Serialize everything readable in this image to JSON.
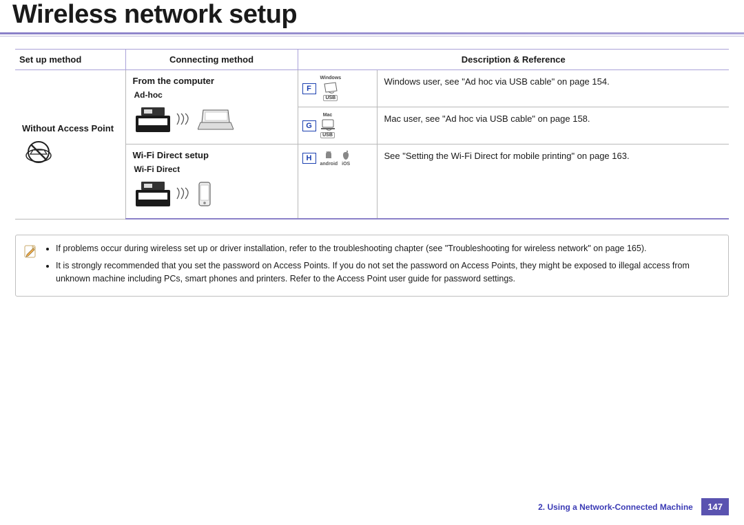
{
  "header": {
    "title": "Wireless network setup"
  },
  "table": {
    "headers": {
      "setup": "Set up method",
      "connecting": "Connecting method",
      "description": "Description & Reference"
    },
    "setup_label": "Without Access Point",
    "rows": {
      "from_computer": {
        "title": "From the computer",
        "subtitle": "Ad-hoc",
        "badges": {
          "f": {
            "letter": "F",
            "os": "Windows",
            "usb": "USB"
          },
          "g": {
            "letter": "G",
            "os": "Mac",
            "usb": "USB"
          }
        },
        "desc_f": "Windows user, see \"Ad hoc via USB cable\" on page 154.",
        "desc_g": "Mac user, see \"Ad hoc via USB cable\" on page 158."
      },
      "wifi_direct": {
        "title": "Wi-Fi Direct setup",
        "subtitle": "Wi-Fi Direct",
        "badge": {
          "letter": "H",
          "os1": "android",
          "os2": "iOS"
        },
        "desc": "See \"Setting the Wi-Fi Direct for mobile printing\" on page 163."
      }
    }
  },
  "notes": {
    "items": [
      "If problems occur during wireless set up or driver installation, refer to the troubleshooting chapter (see \"Troubleshooting for wireless network\" on page 165).",
      "It is strongly recommended that you set the password on Access Points. If you do not set the password on Access Points, they might be exposed to illegal access from unknown machine including PCs, smart phones and printers. Refer to the Access Point user guide for password settings."
    ]
  },
  "footer": {
    "chapter": "2.  Using a Network-Connected Machine",
    "page": "147"
  }
}
